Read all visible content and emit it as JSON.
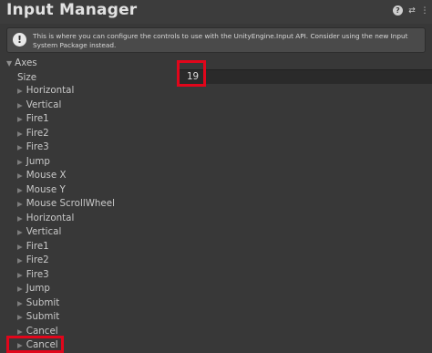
{
  "window": {
    "title": "Input Manager",
    "icons": [
      "help-icon",
      "preset-icon",
      "more-menu-icon"
    ]
  },
  "help_box": {
    "icon": "info-icon",
    "text": "This is where you can configure the controls to use with the UnityEngine.Input API. Consider using the new Input System Package instead."
  },
  "axes": {
    "label": "Axes",
    "expanded": true,
    "size_label": "Size",
    "size_value": "19",
    "items": [
      {
        "label": "Horizontal"
      },
      {
        "label": "Vertical"
      },
      {
        "label": "Fire1"
      },
      {
        "label": "Fire2"
      },
      {
        "label": "Fire3"
      },
      {
        "label": "Jump"
      },
      {
        "label": "Mouse X"
      },
      {
        "label": "Mouse Y"
      },
      {
        "label": "Mouse ScrollWheel"
      },
      {
        "label": "Horizontal"
      },
      {
        "label": "Vertical"
      },
      {
        "label": "Fire1"
      },
      {
        "label": "Fire2"
      },
      {
        "label": "Fire3"
      },
      {
        "label": "Jump"
      },
      {
        "label": "Submit"
      },
      {
        "label": "Submit"
      },
      {
        "label": "Cancel"
      },
      {
        "label": "Cancel"
      }
    ]
  },
  "highlight_color": "#e1061b"
}
